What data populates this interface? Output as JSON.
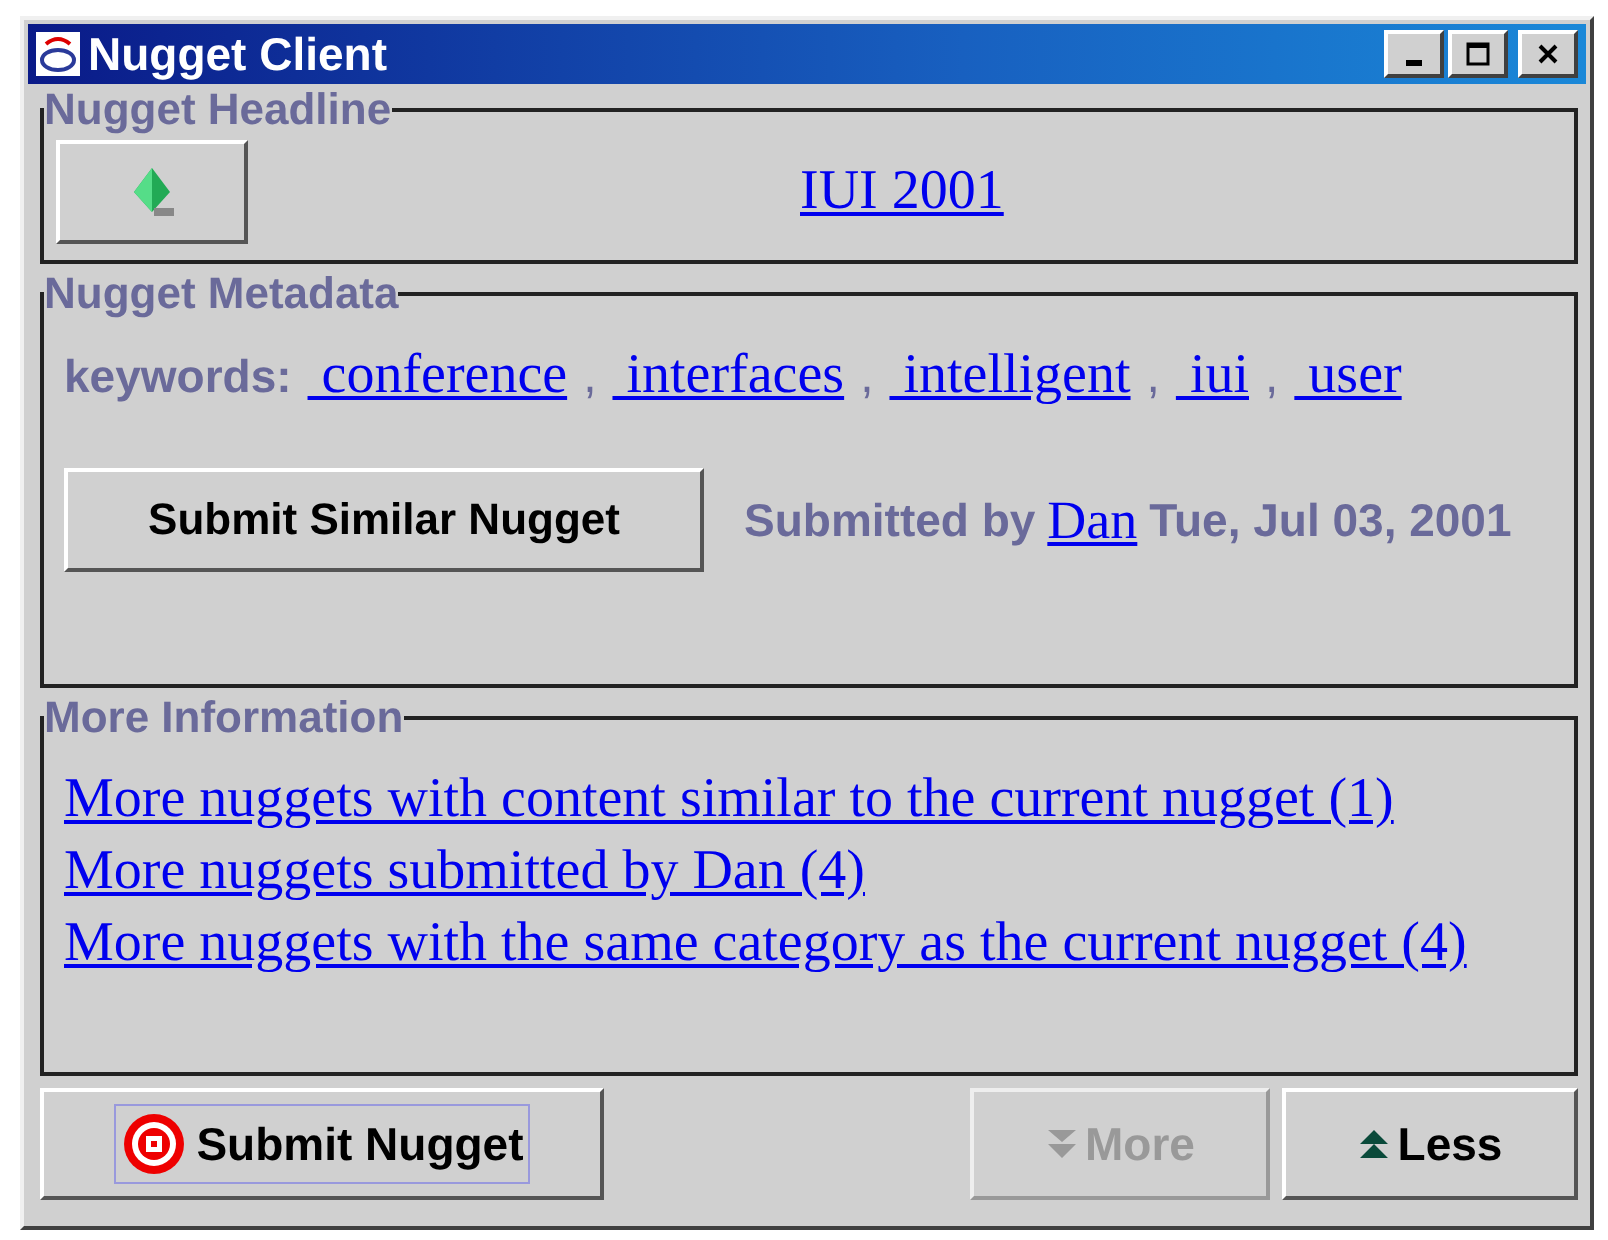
{
  "window": {
    "title": "Nugget Client"
  },
  "headline": {
    "title": "Nugget Headline",
    "link": "IUI 2001"
  },
  "metadata": {
    "title": "Nugget Metadata",
    "keywords_label": "keywords:",
    "separator": ",",
    "keywords": [
      "conference",
      "interfaces",
      "intelligent",
      "iui",
      "user"
    ],
    "submit_similar": "Submit Similar Nugget",
    "submitted_by": "Submitted by",
    "user": "Dan",
    "date": "Tue, Jul 03, 2001"
  },
  "more_info": {
    "title": "More Information",
    "links": [
      "More nuggets with content similar to the current nugget (1)",
      "More nuggets submitted by Dan (4)",
      "More nuggets with the same category as the current nugget (4)"
    ]
  },
  "footer": [
    {
      "kind": "submit",
      "label": "Submit Nugget",
      "disabled": false,
      "focused": true
    },
    {
      "kind": "more",
      "label": "More",
      "disabled": true,
      "focused": false
    },
    {
      "kind": "less",
      "label": "Less",
      "disabled": false,
      "focused": false
    }
  ]
}
